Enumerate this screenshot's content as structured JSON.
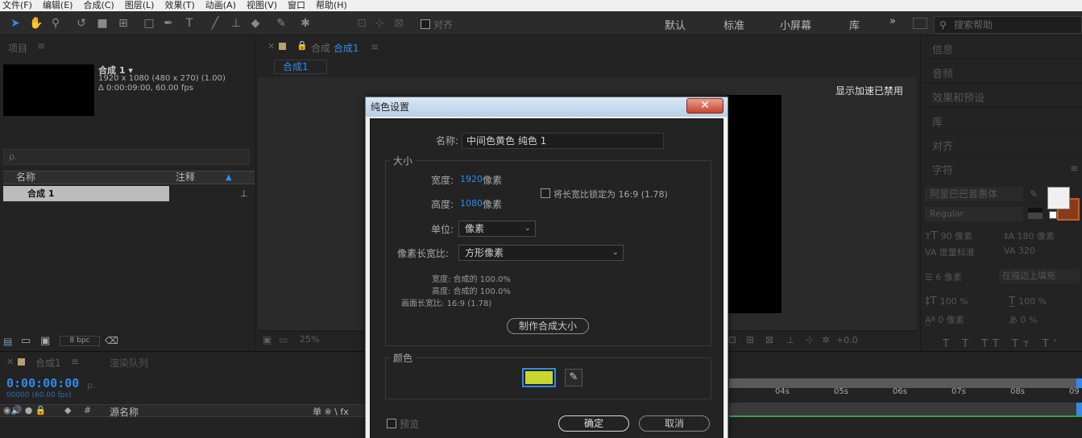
{
  "menu": [
    "文件(F)",
    "编辑(E)",
    "合成(C)",
    "图层(L)",
    "效果(T)",
    "动画(A)",
    "视图(V)",
    "窗口",
    "帮助(H)"
  ],
  "toolbar": {
    "align_label": "对齐",
    "workspaces": [
      "默认",
      "标准",
      "小屏幕",
      "库"
    ],
    "overflow": "»",
    "search_placeholder": "搜索帮助"
  },
  "project": {
    "panel_title": "项目",
    "comp_name": "合成 1 ▾",
    "comp_size": "1920 x 1080  (480 x 270) (1.00)",
    "comp_duration": "Δ 0:00:09:00, 60.00 fps",
    "search_icon": "ρ.",
    "col_name": "名称",
    "col_comment": "注释",
    "row_name": "合成 1",
    "bpc": "8 bpc"
  },
  "comp_viewer": {
    "tab_label": "合成 合成 1",
    "tab_name": "合成1",
    "breadcrumb": "合成1",
    "gpu_notice": "显示加速已禁用",
    "zoom": "25%",
    "offset": "+0.0"
  },
  "right_panel": {
    "items": [
      "信息",
      "音频",
      "效果和预设",
      "库",
      "对齐",
      "字符"
    ],
    "font_name": "阿里巴巴普惠体",
    "font_style": "Regular",
    "font_size": "90 像素",
    "leading": "180 像素",
    "kerning": "度量标准",
    "tracking": "320",
    "stroke_width": "6 像素",
    "stroke_mode": "在描边上填充",
    "v_scale": "100 %",
    "h_scale": "100 %",
    "baseline": "0 像素",
    "tsume": "0 %"
  },
  "timeline": {
    "tab1": "合成1",
    "tab2": "渲染队列",
    "timecode": "0:00:00:00",
    "frames": "00000 (60.00 fps)",
    "col_hash": "#",
    "col_source": "源名称",
    "switch_icons": "单 ※ \\ fx",
    "ticks": [
      "04s",
      "05s",
      "06s",
      "07s",
      "08s",
      "09"
    ]
  },
  "dialog": {
    "title": "纯色设置",
    "close": "✕",
    "name_label": "名称:",
    "name_value": "中间色黄色 纯色 1",
    "size_group": "大小",
    "width_label": "宽度:",
    "width_value": "1920",
    "height_label": "高度:",
    "height_value": "1080",
    "unit_px": "像素",
    "lock_label": "将长宽比锁定为 16:9 (1.78)",
    "units_label": "单位:",
    "units_value": "像素",
    "par_label": "像素长宽比:",
    "par_value": "方形像素",
    "info_width_label": "宽度:",
    "info_width_value": "合成的 100.0%",
    "info_height_label": "高度:",
    "info_height_value": "合成的 100.0%",
    "info_frame_label": "画面长宽比:",
    "info_frame_value": "16:9 (1.78)",
    "make_comp_size": "制作合成大小",
    "color_group": "颜色",
    "color_value": "#c9d62e",
    "preview_label": "预览",
    "ok": "确定",
    "cancel": "取消"
  }
}
